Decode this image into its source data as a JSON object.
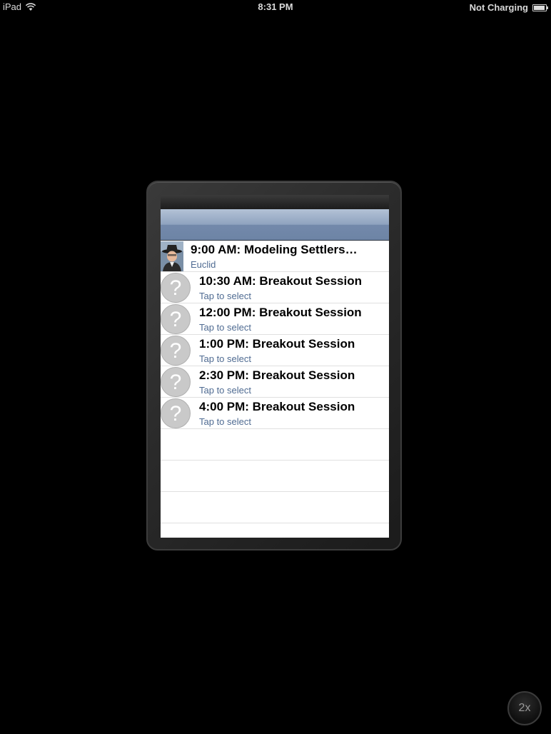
{
  "status_bar": {
    "carrier": "iPad",
    "time": "8:31 PM",
    "charging": "Not Charging"
  },
  "icons": {
    "wifi": "wifi-icon",
    "battery": "battery-icon",
    "placeholder": "question-mark-icon"
  },
  "colors": {
    "nav_bar": "#8fa3bf",
    "subtitle": "#4f6b92",
    "background": "#000000"
  },
  "sessions": [
    {
      "title": "9:00 AM: Modeling Settlers…",
      "subtitle": "Euclid",
      "has_avatar": true
    },
    {
      "title": "10:30 AM: Breakout Session",
      "subtitle": "Tap to select",
      "has_avatar": false
    },
    {
      "title": "12:00 PM: Breakout Session",
      "subtitle": "Tap to select",
      "has_avatar": false
    },
    {
      "title": "1:00 PM: Breakout Session",
      "subtitle": "Tap to select",
      "has_avatar": false
    },
    {
      "title": "2:30 PM: Breakout Session",
      "subtitle": "Tap to select",
      "has_avatar": false
    },
    {
      "title": "4:00 PM: Breakout Session",
      "subtitle": "Tap to select",
      "has_avatar": false
    }
  ],
  "zoom_label": "2x"
}
